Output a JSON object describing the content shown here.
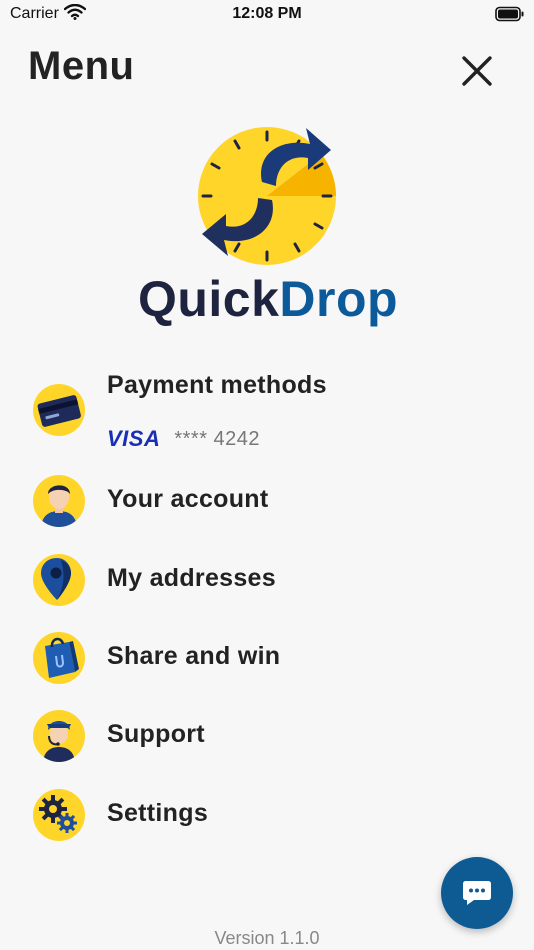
{
  "status_bar": {
    "carrier": "Carrier",
    "time": "12:08 PM"
  },
  "header": {
    "title": "Menu"
  },
  "logo": {
    "word_part1": "Quick",
    "word_part2": "Drop"
  },
  "menu": {
    "payment": {
      "label": "Payment methods",
      "card_brand": "VISA",
      "card_masked": "**** 4242"
    },
    "account": {
      "label": "Your account"
    },
    "addresses": {
      "label": "My addresses"
    },
    "share": {
      "label": "Share and win"
    },
    "support": {
      "label": "Support"
    },
    "settings": {
      "label": "Settings"
    }
  },
  "footer": {
    "version": "Version 1.1.0"
  },
  "colors": {
    "accent_yellow": "#ffd52a",
    "brand_navy": "#1e2440",
    "brand_blue": "#0c5a99",
    "chat_blue": "#0e5b94"
  },
  "icons": [
    "wifi-icon",
    "battery-icon",
    "close-icon",
    "credit-card-icon",
    "user-avatar-icon",
    "location-pin-icon",
    "shopping-bag-icon",
    "support-agent-icon",
    "gears-icon",
    "chat-bubble-icon"
  ]
}
